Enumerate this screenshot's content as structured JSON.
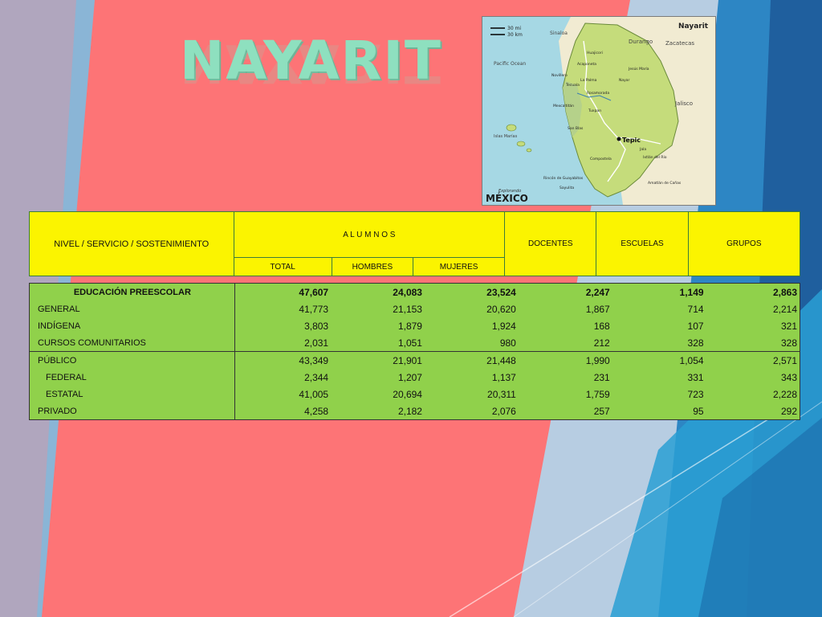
{
  "title": "NAYARIT",
  "map": {
    "scale_mi": "30 mi",
    "scale_km": "30 km",
    "state_label": "Nayarit",
    "brand_top": "Explorando",
    "brand": "MÉXICO",
    "labels": {
      "sinaloa": "Sinaloa",
      "durango": "Durango",
      "zacatecas": "Zacatecas",
      "pacific": "Pacific Ocean",
      "jalisco": "Jalisco",
      "tepic": "Tepic",
      "huajicori": "Huajicori",
      "acaponeta": "Acaponeta",
      "novillero": "Novillero",
      "tecuala": "Tecuala",
      "la_palma": "La Palma",
      "rosamorada": "Rosamorada",
      "mexcaltitan": "Mexcaltitán",
      "tuxpan": "Tuxpan",
      "san_blas": "San Blas",
      "compostela": "Compostela",
      "rincon": "Rincón de Guayabitos",
      "islas_marias": "Islas Marías",
      "sayulita": "Sayulita",
      "jala": "Jala",
      "ixtlan": "Ixtlán del Río",
      "amatlan": "Amatlán de Cañas",
      "jesus_maria": "Jesús María",
      "el_nayar": "Nayar"
    }
  },
  "header": {
    "col_label": "NIVEL / SERVICIO / SOSTENIMIENTO",
    "alumnos": "A L U M N O S",
    "total": "TOTAL",
    "hombres": "HOMBRES",
    "mujeres": "MUJERES",
    "docentes": "DOCENTES",
    "escuelas": "ESCUELAS",
    "grupos": "GRUPOS"
  },
  "rows": [
    {
      "label": "EDUCACIÓN PREESCOLAR",
      "total": "47,607",
      "hombres": "24,083",
      "mujeres": "23,524",
      "docentes": "2,247",
      "escuelas": "1,149",
      "grupos": "2,863"
    },
    {
      "label": "GENERAL",
      "total": "41,773",
      "hombres": "21,153",
      "mujeres": "20,620",
      "docentes": "1,867",
      "escuelas": "714",
      "grupos": "2,214"
    },
    {
      "label": "INDÍGENA",
      "total": "3,803",
      "hombres": "1,879",
      "mujeres": "1,924",
      "docentes": "168",
      "escuelas": "107",
      "grupos": "321"
    },
    {
      "label": "CURSOS COMUNITARIOS",
      "total": "2,031",
      "hombres": "1,051",
      "mujeres": "980",
      "docentes": "212",
      "escuelas": "328",
      "grupos": "328"
    },
    {
      "label": "PÚBLICO",
      "total": "43,349",
      "hombres": "21,901",
      "mujeres": "21,448",
      "docentes": "1,990",
      "escuelas": "1,054",
      "grupos": "2,571"
    },
    {
      "label": "FEDERAL",
      "total": "2,344",
      "hombres": "1,207",
      "mujeres": "1,137",
      "docentes": "231",
      "escuelas": "331",
      "grupos": "343"
    },
    {
      "label": "ESTATAL",
      "total": "41,005",
      "hombres": "20,694",
      "mujeres": "20,311",
      "docentes": "1,759",
      "escuelas": "723",
      "grupos": "2,228"
    },
    {
      "label": "PRIVADO",
      "total": "4,258",
      "hombres": "2,182",
      "mujeres": "2,076",
      "docentes": "257",
      "escuelas": "95",
      "grupos": "292"
    }
  ],
  "colors": {
    "background": "#fd7476",
    "title": "#8ee0bf",
    "header_fill": "#fbf400",
    "data_fill": "#90d14b",
    "accent_dark_blue": "#1f5f9e",
    "accent_light_blue": "#2a9fd4"
  }
}
